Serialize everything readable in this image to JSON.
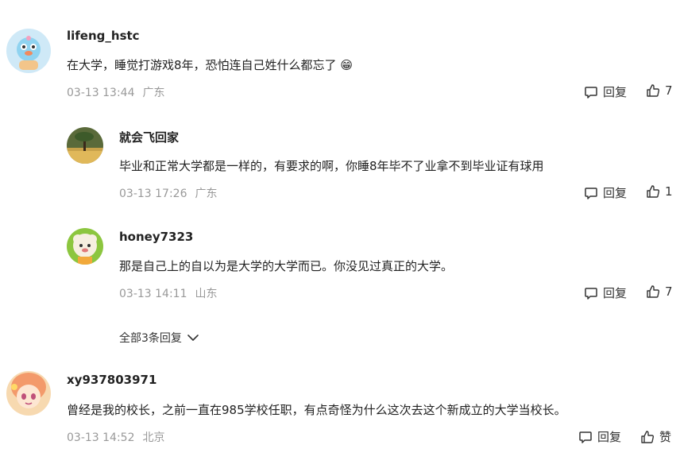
{
  "comments": [
    {
      "user": "lifeng_hstc",
      "text": "在大学，睡觉打游戏8年，恐怕连自己姓什么都忘了",
      "emoji": "😁",
      "time": "03-13 13:44",
      "location": "广东",
      "reply_label": "回复",
      "like_count": "7"
    },
    {
      "user": "就会飞回家",
      "text": "毕业和正常大学都是一样的，有要求的啊，你睡8年毕不了业拿不到毕业证有球用",
      "time": "03-13 17:26",
      "location": "广东",
      "reply_label": "回复",
      "like_count": "1"
    },
    {
      "user": "honey7323",
      "text": "那是自己上的自以为是大学的大学而已。你没见过真正的大学。",
      "time": "03-13 14:11",
      "location": "山东",
      "reply_label": "回复",
      "like_count": "7"
    },
    {
      "user": "xy937803971",
      "text": "曾经是我的校长，之前一直在985学校任职，有点奇怪为什么这次去这个新成立的大学当校长。",
      "time": "03-13 14:52",
      "location": "北京",
      "reply_label": "回复",
      "like_count": "赞"
    }
  ],
  "expand_replies_label": "全部3条回复",
  "icons": {
    "reply": "reply-bubble-icon",
    "like": "thumbs-up-icon",
    "expand": "chevron-down-icon"
  }
}
